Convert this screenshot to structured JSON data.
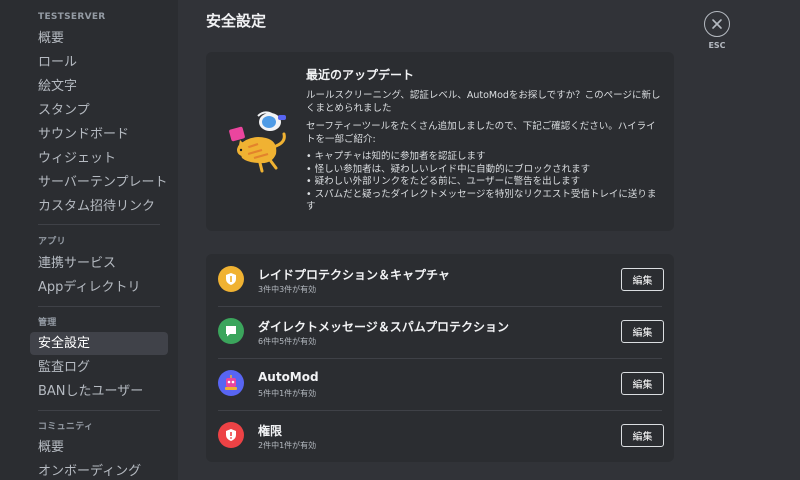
{
  "sidebar": {
    "server_header": "TESTSERVER",
    "server_items": [
      {
        "label": "概要"
      },
      {
        "label": "ロール"
      },
      {
        "label": "絵文字"
      },
      {
        "label": "スタンプ"
      },
      {
        "label": "サウンドボード"
      },
      {
        "label": "ウィジェット"
      },
      {
        "label": "サーバーテンプレート"
      },
      {
        "label": "カスタム招待リンク"
      }
    ],
    "apps_header": "アプリ",
    "apps_items": [
      {
        "label": "連携サービス"
      },
      {
        "label": "Appディレクトリ"
      }
    ],
    "mod_header": "管理",
    "mod_items": [
      {
        "label": "安全設定",
        "active": true
      },
      {
        "label": "監査ログ"
      },
      {
        "label": "BANしたユーザー"
      }
    ],
    "community_header": "コミュニティ",
    "community_items": [
      {
        "label": "概要"
      },
      {
        "label": "オンボーディング"
      }
    ]
  },
  "page": {
    "title": "安全設定"
  },
  "close": {
    "label": "ESC",
    "icon": "close-icon"
  },
  "update_card": {
    "title": "最近のアップデート",
    "p1": "ルールスクリーニング、認証レベル、AutoModをお探しですか？このページに新しくまとめられました",
    "p2": "セーフティーツールをたくさん追加しましたので、下記ご確認ください。ハイライトを一部ご紹介:",
    "bullets": [
      "• キャプチャは知的に参加者を認証します",
      "• 怪しい参加者は、疑わしいレイド中に自動的にブロックされます",
      "• 疑わしい外部リンクをたどる前に、ユーザーに警告を出します",
      "• スパムだと疑ったダイレクトメッセージを特別なリクエスト受信トレイに送ります"
    ]
  },
  "settings": [
    {
      "title": "レイドプロテクション＆キャプチャ",
      "sub": "3件中3件が有効",
      "button": "編集",
      "icon": "shield-icon",
      "color": "#f0b232"
    },
    {
      "title": "ダイレクトメッセージ＆スパムプロテクション",
      "sub": "6件中5件が有効",
      "button": "編集",
      "icon": "chat-bubble-icon",
      "color": "#3ba55c"
    },
    {
      "title": "AutoMod",
      "sub": "5件中1件が有効",
      "button": "編集",
      "icon": "automod-icon",
      "color": "#5865f2"
    },
    {
      "title": "権限",
      "sub": "2件中1件が有効",
      "button": "編集",
      "icon": "shield-alert-icon",
      "color": "#ed4245"
    }
  ]
}
